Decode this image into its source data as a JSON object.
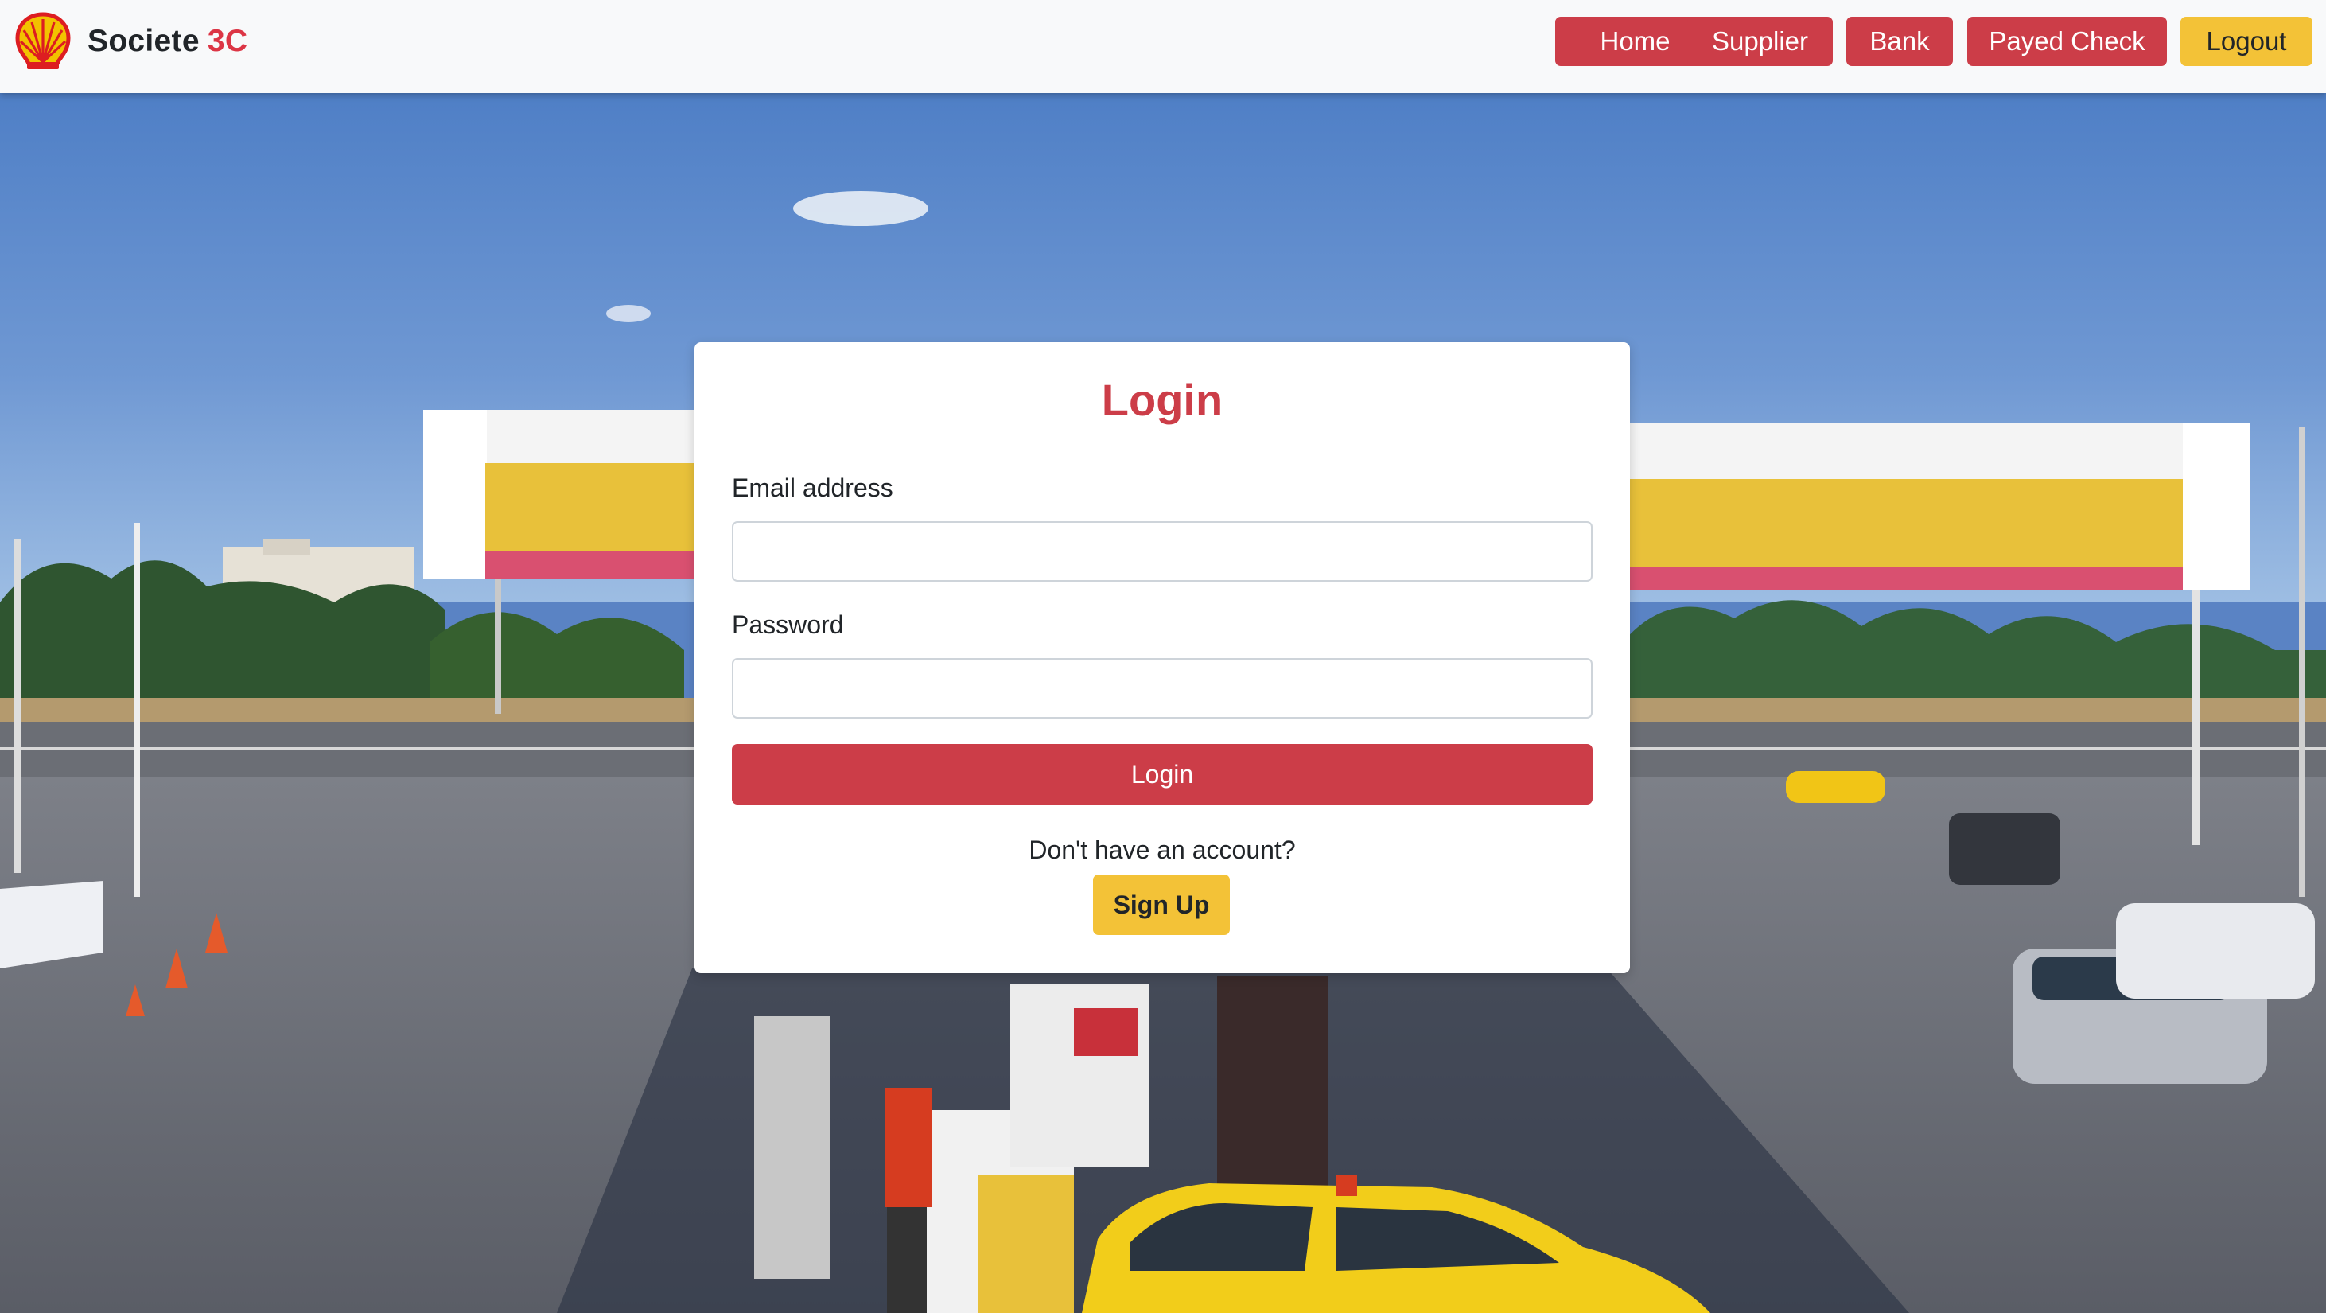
{
  "navbar": {
    "brand_name": "Societe",
    "brand_accent": "3C",
    "logo_icon": "shell-logo",
    "links": [
      {
        "label": "Home",
        "style": "danger"
      },
      {
        "label": "Supplier",
        "style": "danger"
      },
      {
        "label": "Bank",
        "style": "danger"
      },
      {
        "label": "Payed Check",
        "style": "danger"
      },
      {
        "label": "Logout",
        "style": "warning"
      }
    ]
  },
  "login": {
    "title": "Login",
    "email_label": "Email address",
    "email_value": "",
    "password_label": "Password",
    "password_value": "",
    "submit_label": "Login",
    "signup_prompt": "Don't have an account?",
    "signup_label": "Sign Up"
  },
  "colors": {
    "danger": "#cc3d48",
    "warning": "#f3c237",
    "navbar_bg": "#f8f9fa",
    "text": "#212529"
  }
}
